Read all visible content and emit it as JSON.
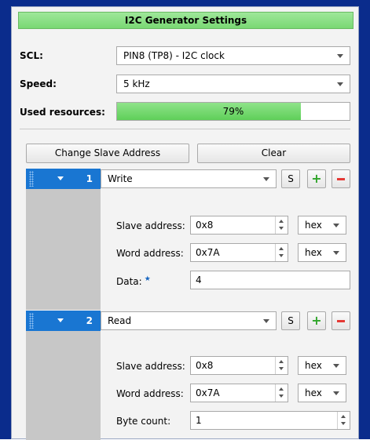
{
  "title": "I2C Generator Settings",
  "scl": {
    "label": "SCL:",
    "value": "PIN8 (TP8) - I2C clock"
  },
  "speed": {
    "label": "Speed:",
    "value": "5 kHz"
  },
  "resources": {
    "label": "Used resources:",
    "percent_text": "79%",
    "fraction": 0.79
  },
  "buttons": {
    "change_slave": "Change Slave Address",
    "clear": "Clear"
  },
  "operations": [
    {
      "index": "1",
      "type": "Write",
      "s_label": "S",
      "slave_address": {
        "label": "Slave address:",
        "value": "0x8",
        "format": "hex"
      },
      "word_address": {
        "label": "Word address:",
        "value": "0x7A",
        "format": "hex"
      },
      "data": {
        "label": "Data:",
        "value": "4"
      }
    },
    {
      "index": "2",
      "type": "Read",
      "s_label": "S",
      "slave_address": {
        "label": "Slave address:",
        "value": "0x8",
        "format": "hex"
      },
      "word_address": {
        "label": "Word address:",
        "value": "0x7A",
        "format": "hex"
      },
      "byte_count": {
        "label": "Byte count:",
        "value": "1"
      }
    }
  ],
  "colors": {
    "accent_green": "#79d873",
    "handle_blue": "#1976d2",
    "frame_blue": "#0a2c8c"
  }
}
